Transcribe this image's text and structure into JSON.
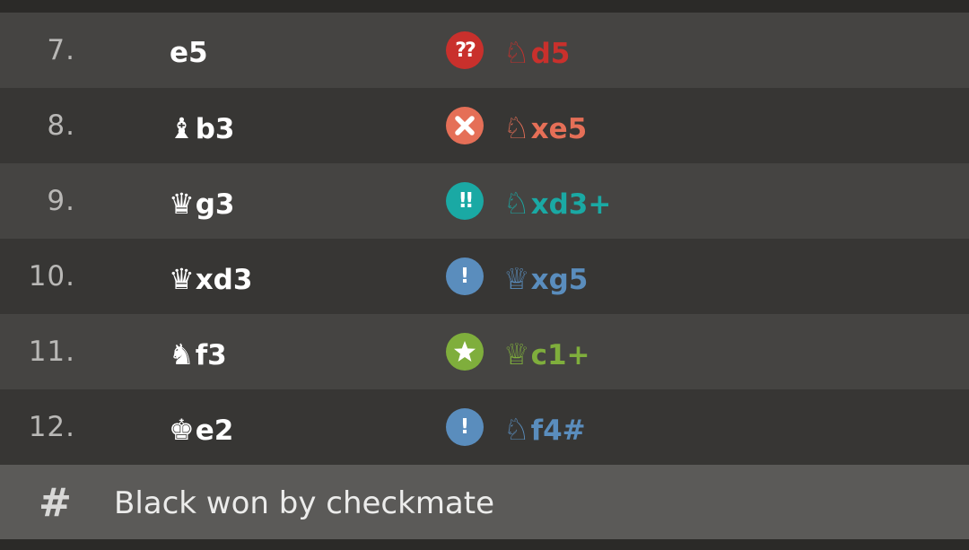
{
  "moves": [
    {
      "number": "7.",
      "white": {
        "piece": "",
        "text": "e5"
      },
      "badge": {
        "type": "blunder",
        "glyph": "??",
        "color": "#c9302c"
      },
      "black": {
        "piece": "♘",
        "text": "d5",
        "color": "#c9302c"
      }
    },
    {
      "number": "8.",
      "white": {
        "piece": "♝",
        "text": "b3"
      },
      "badge": {
        "type": "mistake",
        "glyph": "x-icon",
        "color": "#e56f57"
      },
      "black": {
        "piece": "♘",
        "text": "xe5",
        "color": "#e56f57"
      }
    },
    {
      "number": "9.",
      "white": {
        "piece": "♛",
        "text": "g3"
      },
      "badge": {
        "type": "brilliant",
        "glyph": "!!",
        "color": "#1aa9a4"
      },
      "black": {
        "piece": "♘",
        "text": "xd3+",
        "color": "#1aa9a4"
      }
    },
    {
      "number": "10.",
      "white": {
        "piece": "♛",
        "text": "xd3"
      },
      "badge": {
        "type": "great",
        "glyph": "!",
        "color": "#5a8dbd"
      },
      "black": {
        "piece": "♕",
        "text": "xg5",
        "color": "#5a8dbd"
      }
    },
    {
      "number": "11.",
      "white": {
        "piece": "♞",
        "text": "f3"
      },
      "badge": {
        "type": "best",
        "glyph": "star-icon",
        "color": "#7fae3c"
      },
      "black": {
        "piece": "♕",
        "text": "c1+",
        "color": "#7fae3c"
      }
    },
    {
      "number": "12.",
      "white": {
        "piece": "♚",
        "text": "e2"
      },
      "badge": {
        "type": "great",
        "glyph": "!",
        "color": "#5a8dbd"
      },
      "black": {
        "piece": "♘",
        "text": "f4#",
        "color": "#5a8dbd"
      }
    }
  ],
  "result": {
    "icon": "#",
    "text": "Black won by checkmate"
  }
}
